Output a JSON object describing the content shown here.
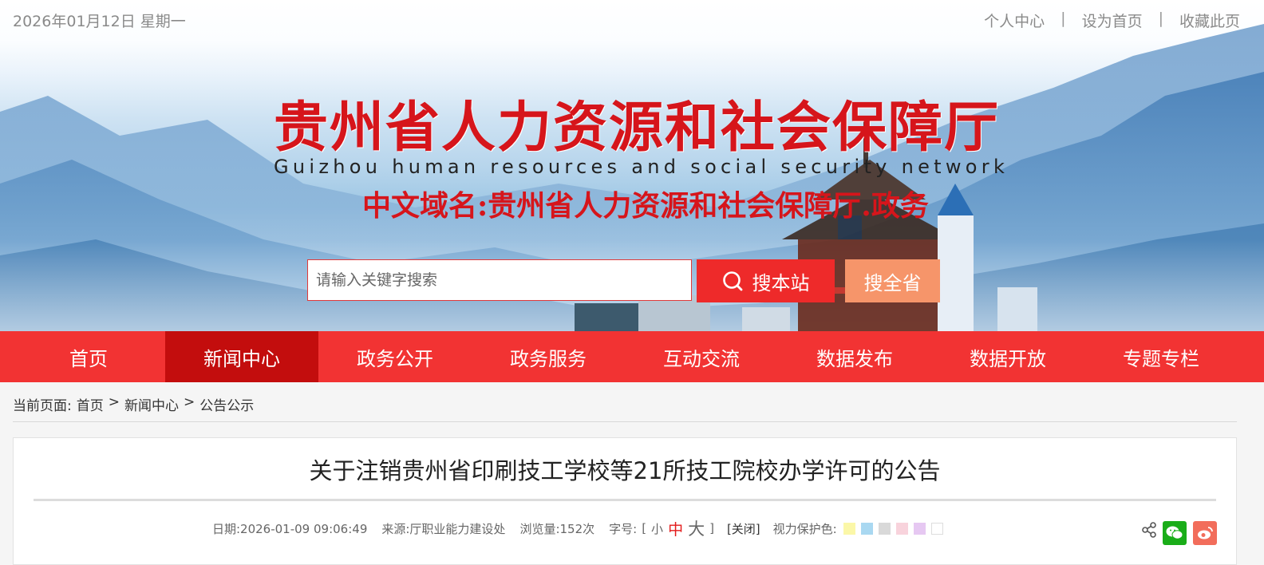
{
  "topbar": {
    "date": "2026年01月12日 星期一",
    "links": [
      "个人中心",
      "设为首页",
      "收藏此页"
    ],
    "separator": "|"
  },
  "banner": {
    "title": "贵州省人力资源和社会保障厅",
    "subtitle": "Guizhou human resources and social security network",
    "domain": "中文域名:贵州省人力资源和社会保障厅.政务"
  },
  "search": {
    "placeholder": "请输入关键字搜索",
    "site_button": "搜本站",
    "province_button": "搜全省"
  },
  "nav": {
    "items": [
      "首页",
      "新闻中心",
      "政务公开",
      "政务服务",
      "互动交流",
      "数据发布",
      "数据开放",
      "专题专栏"
    ],
    "active_index": 1
  },
  "breadcrumb": {
    "prefix": "当前页面:",
    "items": [
      "首页",
      "新闻中心",
      "公告公示"
    ],
    "sep": ">"
  },
  "article": {
    "title": "关于注销贵州省印刷技工学校等21所技工院校办学许可的公告",
    "date": "日期:2026-01-09 09:06:49",
    "source": "来源:厅职业能力建设处",
    "views": "浏览量:152次",
    "font_label": "字号:",
    "font_open": "[",
    "font_small": "小",
    "font_mid": "中",
    "font_big": "大",
    "font_close": "]",
    "close_label": "[关闭]",
    "eye_label": "视力保护色:",
    "eye_colors": [
      "#fbf7a8",
      "#a9d8f1",
      "#d9d9d9",
      "#f8d3dc",
      "#e6c8f2",
      "#ffffff"
    ]
  },
  "colors": {
    "brand_red": "#f23333",
    "nav_active": "#c30d0d",
    "province_btn": "#f6956a"
  }
}
